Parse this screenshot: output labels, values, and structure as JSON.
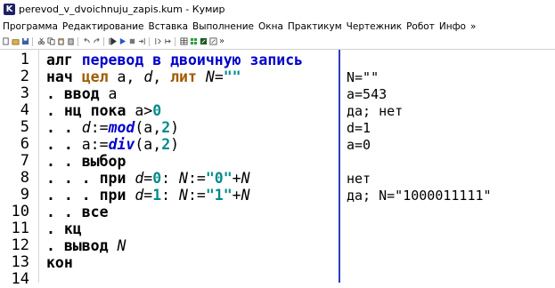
{
  "window": {
    "title": "perevod_v_dvoichnuju_zapis.kum - Кумир",
    "icon": "kumir-app-icon"
  },
  "menu": [
    "Программа",
    "Редактирование",
    "Вставка",
    "Выполнение",
    "Окна",
    "Практикум",
    "Чертежник",
    "Робот",
    "Инфо",
    "»"
  ],
  "toolbar_more": "»",
  "line_numbers": [
    "1",
    "2",
    "3",
    "4",
    "5",
    "6",
    "7",
    "8",
    "9",
    "10",
    "11",
    "12",
    "13",
    "14"
  ],
  "code": {
    "l1_kw": "алг",
    "l1_name": " перевод в двоичную запись",
    "l2_nach": "нач",
    "l2_cel": "цел",
    "l2_vars": " a, ",
    "l2_d": "d",
    "l2_comma": ", ",
    "l2_lit": "лит",
    "l2_N": "N",
    "l2_eq": "=",
    "l2_str": "\"\"",
    "dot1": ". ",
    "dot2": ". . ",
    "dot3": ". . . ",
    "l3_kw": "ввод",
    "l3_rest": " a",
    "l4_kw": "нц пока",
    "l4_rest": " a>",
    "l4_num": "0",
    "l5_d": "d",
    "l5_assign": ":=",
    "l5_fn": "mod",
    "l5_args": "(a,",
    "l5_num": "2",
    "l5_close": ")",
    "l6_a": "a:=",
    "l6_fn": "div",
    "l6_args": "(a,",
    "l6_num": "2",
    "l6_close": ")",
    "l7_kw": "выбор",
    "l8_kw": "при",
    "l8_d": "d",
    "l8_eq": "=",
    "l8_num": "0",
    "l8_colon": ": ",
    "l8_N": "N",
    "l8_assign": ":=",
    "l8_str": "\"0\"",
    "l8_plus": "+",
    "l8_N2": "N",
    "l9_kw": "при",
    "l9_d": "d",
    "l9_eq": "=",
    "l9_num": "1",
    "l9_colon": ": ",
    "l9_N": "N",
    "l9_assign": ":=",
    "l9_str": "\"1\"",
    "l9_plus": "+",
    "l9_N2": "N",
    "l10_kw": "все",
    "l11_kw": "кц",
    "l12_kw": "вывод",
    "l12_N": "N",
    "l13_kw": "кон"
  },
  "margin": {
    "l2": "N=\"\"",
    "l3": "a=543",
    "l4": "да; нет",
    "l5": "d=1",
    "l6": "a=0",
    "l8": "нет",
    "l9": "да; N=\"1000011111\""
  },
  "colors": {
    "keyword_blue": "#0000cc",
    "type_brown": "#a05a00",
    "literal_teal": "#008b8b",
    "divider": "#2a3dbf"
  }
}
